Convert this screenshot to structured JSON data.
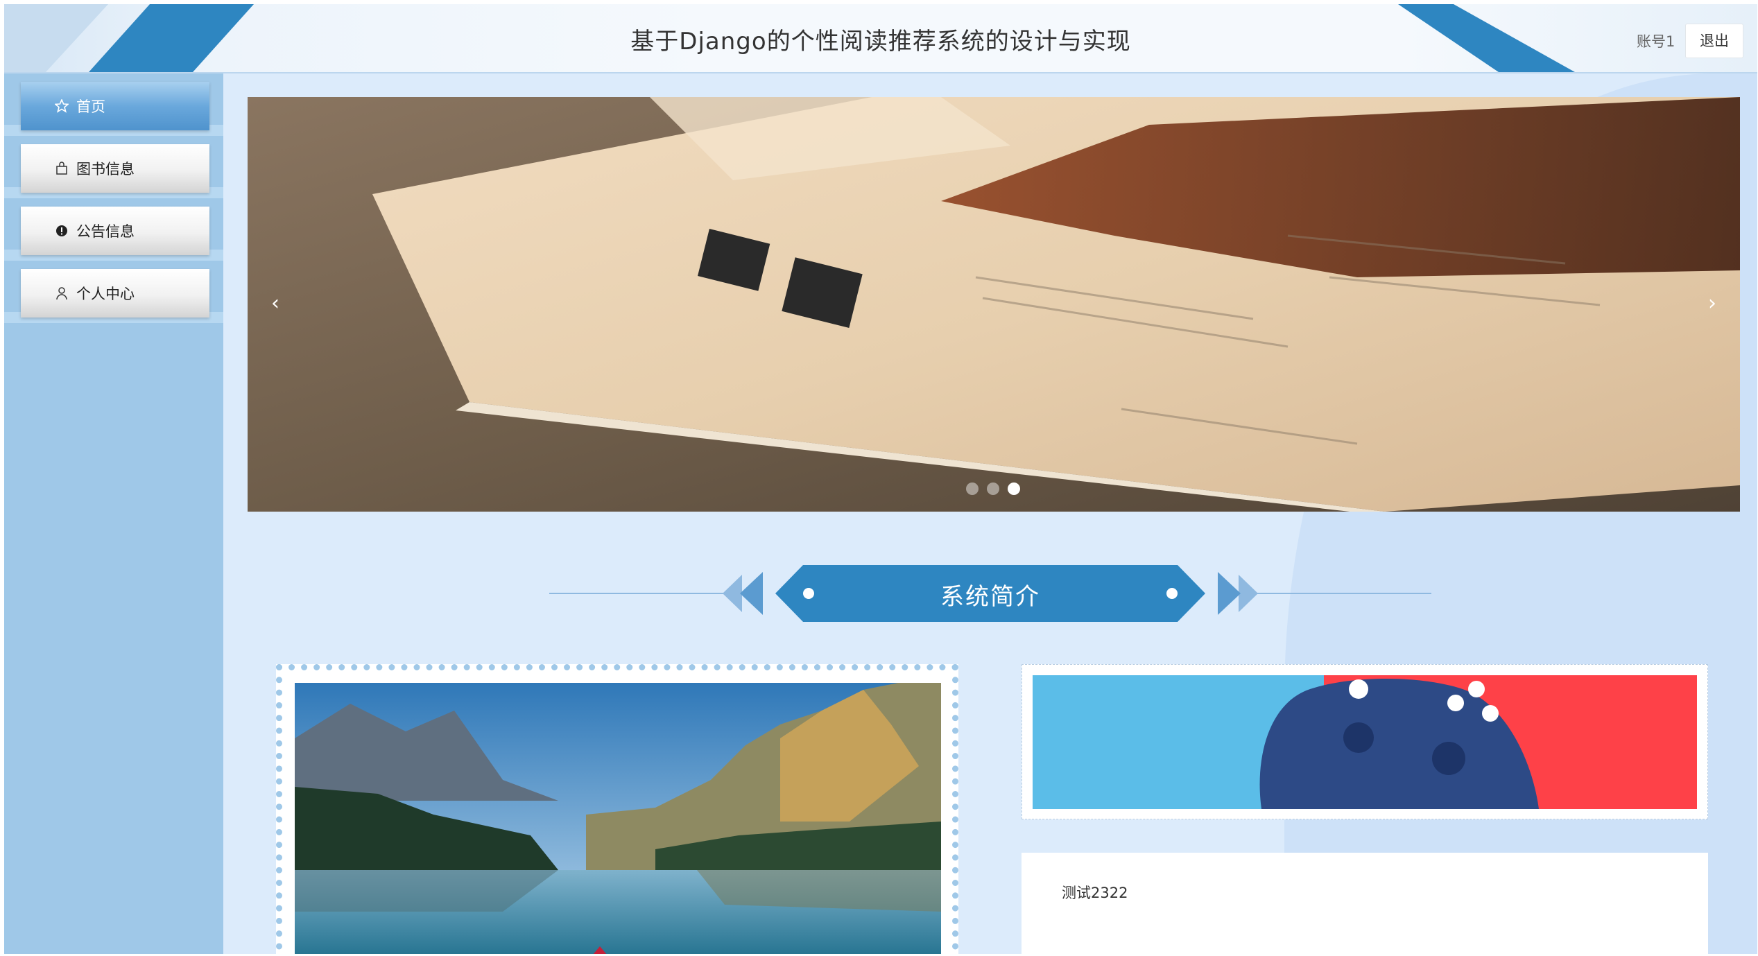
{
  "header": {
    "title": "基于Django的个性阅读推荐系统的设计与实现",
    "account_label": "账号1",
    "logout_label": "退出"
  },
  "sidebar": {
    "items": [
      {
        "label": "首页",
        "icon": "star-icon",
        "active": true
      },
      {
        "label": "图书信息",
        "icon": "bag-icon",
        "active": false
      },
      {
        "label": "公告信息",
        "icon": "info-icon",
        "active": false
      },
      {
        "label": "个人中心",
        "icon": "user-icon",
        "active": false
      }
    ]
  },
  "carousel": {
    "slide_count": 3,
    "active_index": 2,
    "prev_label": "‹",
    "next_label": "›"
  },
  "section": {
    "title": "系统简介"
  },
  "intro": {
    "text": "测试2322"
  },
  "colors": {
    "accent": "#2e86c1",
    "sidebar_bg": "#9fc8e8",
    "page_bg": "#dcebfb"
  }
}
